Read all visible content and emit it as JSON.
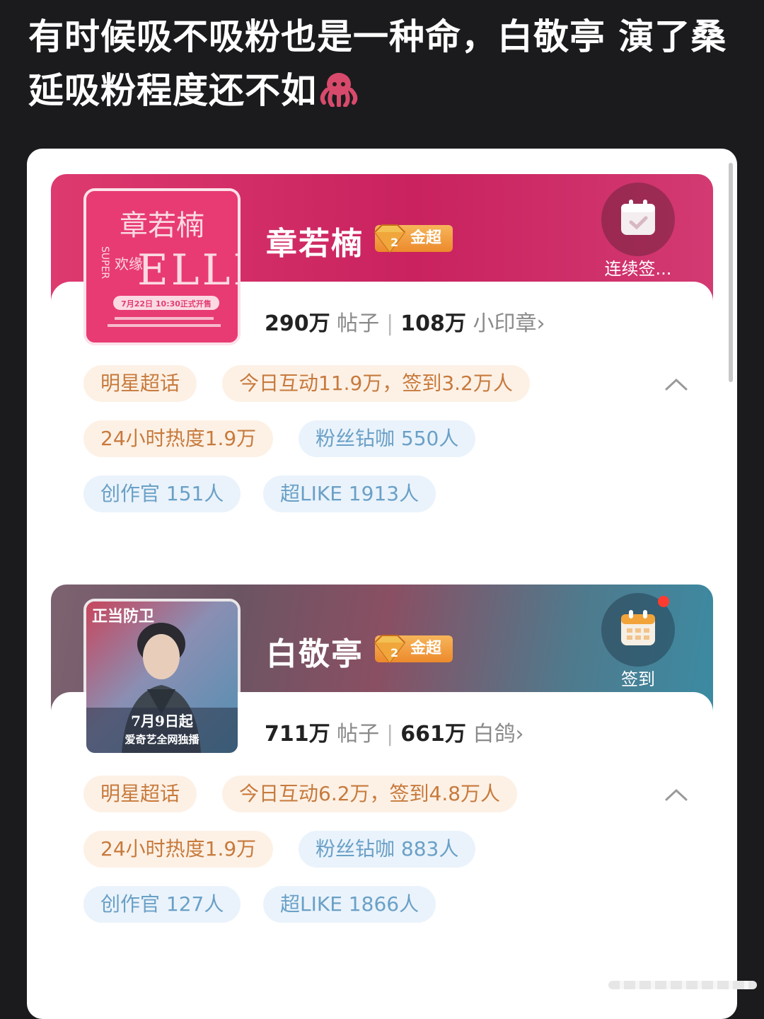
{
  "post": {
    "title": "有时候吸不吸粉也是一种命，白敬亭 演了桑延吸粉程度还不如",
    "emoji_icon": "octopus-emoji-icon"
  },
  "cards": [
    {
      "name": "章若楠",
      "badge": "金超",
      "checkin_label": "连续签...",
      "checkin_icon": "calendar-check-icon",
      "posts_count": "290万",
      "posts_label": "帖子",
      "fans_count": "108万",
      "fans_label": "小印章",
      "cover": {
        "title": "章若楠",
        "brand": "ELLE",
        "side": "SUPER",
        "chars": "欢缘",
        "date": "7月22日 10:30正式开售"
      },
      "tags": {
        "category": "明星超话",
        "today": "今日互动11.9万，签到3.2万人",
        "heat": "24小时热度1.9万",
        "vip": "粉丝钻咖 550人",
        "creators": "创作官 151人",
        "superlike": "超LIKE 1913人"
      }
    },
    {
      "name": "白敬亭",
      "badge": "金超",
      "checkin_label": "签到",
      "checkin_icon": "calendar-icon",
      "posts_count": "711万",
      "posts_label": "帖子",
      "fans_count": "661万",
      "fans_label": "白鸽",
      "cover": {
        "title": "正当防卫",
        "date": "7月9日起",
        "platform": "爱奇艺全网独播"
      },
      "tags": {
        "category": "明星超话",
        "today": "今日互动6.2万，签到4.8万人",
        "heat": "24小时热度1.9万",
        "vip": "粉丝钻咖 883人",
        "creators": "创作官 127人",
        "superlike": "超LIKE 1866人"
      }
    }
  ],
  "colors": {
    "card1_banner": "#d02c66",
    "card2_banner_left": "#7d6270",
    "card2_banner_right": "#3b8ba3",
    "badge_orange": "#ec8a2c",
    "tag_orange_text": "#c77a3c",
    "tag_blue_text": "#6aa0c7"
  }
}
